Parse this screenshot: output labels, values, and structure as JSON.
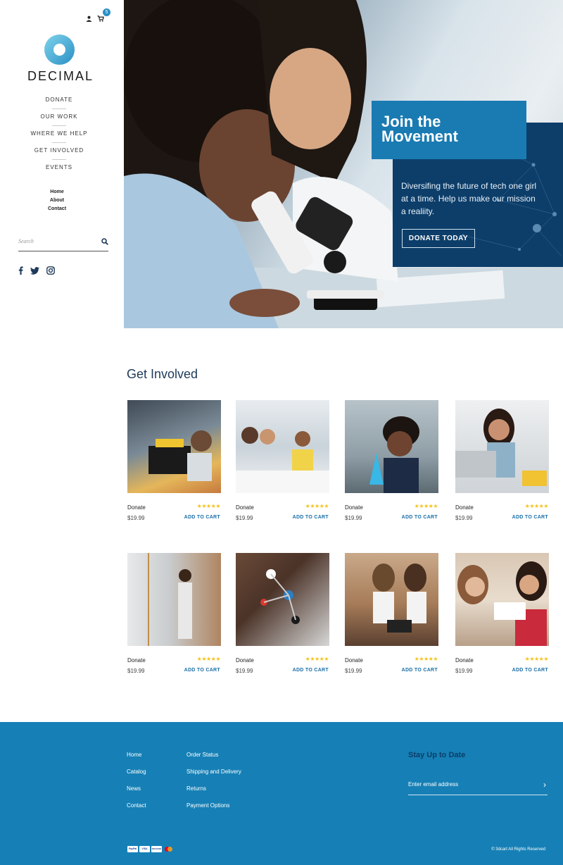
{
  "header": {
    "user_icon": "user-icon",
    "cart_icon": "cart-icon",
    "cart_count": "5"
  },
  "brand": {
    "name": "DECIMAL",
    "logo_icon": "ring-logo-icon",
    "colors": {
      "logo_light": "#7fd3ec",
      "logo_dark": "#2a8fc4"
    }
  },
  "nav": {
    "main": [
      "DONATE",
      "OUR WORK",
      "WHERE WE HELP",
      "GET INVOLVED",
      "EVENTS"
    ],
    "sub": [
      "Home",
      "About",
      "Contact"
    ]
  },
  "search": {
    "placeholder": "Search",
    "icon": "search-icon"
  },
  "social": [
    "facebook-icon",
    "twitter-icon",
    "instagram-icon"
  ],
  "hero": {
    "title": "Join the Movement",
    "text": "Diversifing the future of tech one girl at a time. Help us make our mission a realiity.",
    "button": "DONATE TODAY",
    "colors": {
      "panel": "#0d3e6a",
      "title_box": "#1a7bb2"
    }
  },
  "get_involved": {
    "title": "Get Involved",
    "products": [
      {
        "name": "Donate",
        "price": "$19.99",
        "rating": "★★★★★",
        "cta": "ADD TO CART"
      },
      {
        "name": "Donate",
        "price": "$19.99",
        "rating": "★★★★★",
        "cta": "ADD TO CART"
      },
      {
        "name": "Donate",
        "price": "$19.99",
        "rating": "★★★★★",
        "cta": "ADD TO CART"
      },
      {
        "name": "Donate",
        "price": "$19.99",
        "rating": "★★★★★",
        "cta": "ADD TO CART"
      },
      {
        "name": "Donate",
        "price": "$19.99",
        "rating": "★★★★★",
        "cta": "ADD TO CART"
      },
      {
        "name": "Donate",
        "price": "$19.99",
        "rating": "★★★★★",
        "cta": "ADD TO CART"
      },
      {
        "name": "Donate",
        "price": "$19.99",
        "rating": "★★★★★",
        "cta": "ADD TO CART"
      },
      {
        "name": "Donate",
        "price": "$19.99",
        "rating": "★★★★★",
        "cta": "ADD TO CART"
      }
    ]
  },
  "footer": {
    "col1": [
      "Home",
      "Catalog",
      "News",
      "Contact"
    ],
    "col2": [
      "Order Status",
      "Shipping and Delivery",
      "Returns",
      "Payment Options"
    ],
    "newsletter_title": "Stay Up to Date",
    "email_placeholder": "Enter email address",
    "payments": [
      "PayPal",
      "VISA",
      "DISCOVER",
      "mastercard"
    ],
    "copyright": "© 3dcart All Rights Reserved",
    "colors": {
      "background": "#1680b6",
      "heading": "#0b3d66"
    }
  }
}
